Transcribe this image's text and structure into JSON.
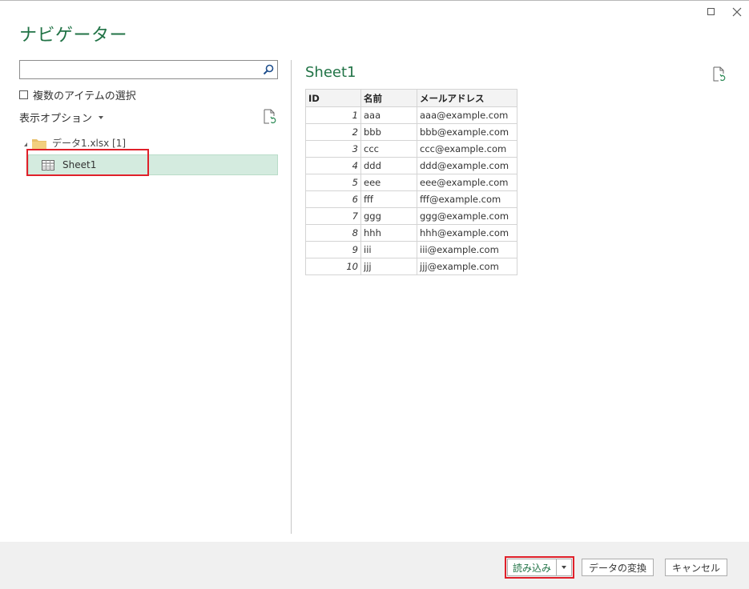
{
  "dialog": {
    "title": "ナビゲーター"
  },
  "window": {
    "maximize_icon": "maximize-icon",
    "close_icon": "close-icon"
  },
  "left_pane": {
    "search": {
      "value": "",
      "placeholder": ""
    },
    "multi_select_label": "複数のアイテムの選択",
    "display_options_label": "表示オプション",
    "tree": {
      "folder_label": "データ1.xlsx [1]",
      "items": [
        {
          "label": "Sheet1",
          "selected": true
        }
      ]
    }
  },
  "preview": {
    "title": "Sheet1",
    "columns": [
      "ID",
      "名前",
      "メールアドレス"
    ],
    "rows": [
      [
        "1",
        "aaa",
        "aaa@example.com"
      ],
      [
        "2",
        "bbb",
        "bbb@example.com"
      ],
      [
        "3",
        "ccc",
        "ccc@example.com"
      ],
      [
        "4",
        "ddd",
        "ddd@example.com"
      ],
      [
        "5",
        "eee",
        "eee@example.com"
      ],
      [
        "6",
        "fff",
        "fff@example.com"
      ],
      [
        "7",
        "ggg",
        "ggg@example.com"
      ],
      [
        "8",
        "hhh",
        "hhh@example.com"
      ],
      [
        "9",
        "iii",
        "iii@example.com"
      ],
      [
        "10",
        "jjj",
        "jjj@example.com"
      ]
    ]
  },
  "footer": {
    "load_label": "読み込み",
    "transform_label": "データの変換",
    "cancel_label": "キャンセル"
  },
  "colors": {
    "accent": "#217346",
    "selection": "#d4ebdf",
    "highlight": "#e0202a"
  }
}
